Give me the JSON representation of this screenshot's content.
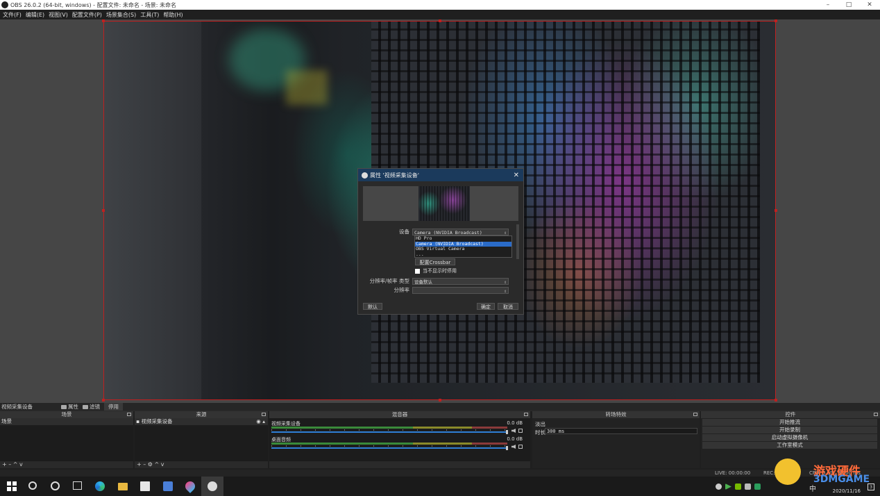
{
  "window": {
    "title": "OBS 26.0.2 (64-bit, windows) - 配置文件: 未命名 - 场景: 未命名",
    "controls": [
      "–",
      "□",
      "✕"
    ]
  },
  "menu": [
    "文件(F)",
    "编辑(E)",
    "视图(V)",
    "配置文件(P)",
    "场景集合(S)",
    "工具(T)",
    "帮助(H)"
  ],
  "dialog": {
    "title": "属性 '视频采集设备'",
    "close": "✕",
    "device_label": "设备",
    "device_value": "Camera (NVIDIA Broadcast)",
    "device_options": [
      "HD Pro",
      "Camera (NVIDIA Broadcast)",
      "OBS Virtual Camera",
      "..."
    ],
    "crossbar_button": "配置Crossbar",
    "checkbox_label": "当不显示时停用",
    "resolution_label": "分辨率/帧率 类型",
    "resolution_value": "设备默认",
    "resolution_field_label": "分辨率",
    "defaults_button": "默认",
    "ok_button": "确定",
    "cancel_button": "取消"
  },
  "source_toolbar": {
    "source_name": "视频采集设备",
    "properties": "属性",
    "filters": "滤镜",
    "deactivate": "停用"
  },
  "docks": {
    "scenes": {
      "title": "场景",
      "items": [
        "场景"
      ],
      "footer": "+ – ^ v"
    },
    "sources": {
      "title": "来源",
      "items": [
        "视频采集设备"
      ],
      "footer": "+ – ⚙ ^ v"
    },
    "mixer": {
      "title": "混音器",
      "channels": [
        {
          "name": "视频采集设备",
          "db": "0.0 dB"
        },
        {
          "name": "桌面音频",
          "db": "0.0 dB"
        }
      ]
    },
    "transitions": {
      "title": "转场特效",
      "type": "淡出",
      "duration_label": "时长",
      "duration_value": "300 ms"
    },
    "controls": {
      "title": "控件",
      "buttons": [
        "开始推流",
        "开始录制",
        "启动虚拟摄像机",
        "工作室模式"
      ]
    }
  },
  "status": {
    "live": "LIVE: 00:00:00",
    "rec": "REC: 00:00:00",
    "cpu": "CPU: 0.9%, 30.00 fps"
  },
  "taskbar": {
    "date": "2020/11/16",
    "ime": "中",
    "notification_count": "3"
  },
  "watermark": {
    "line1": "游戏硬件",
    "line2": "3DMGAME"
  }
}
